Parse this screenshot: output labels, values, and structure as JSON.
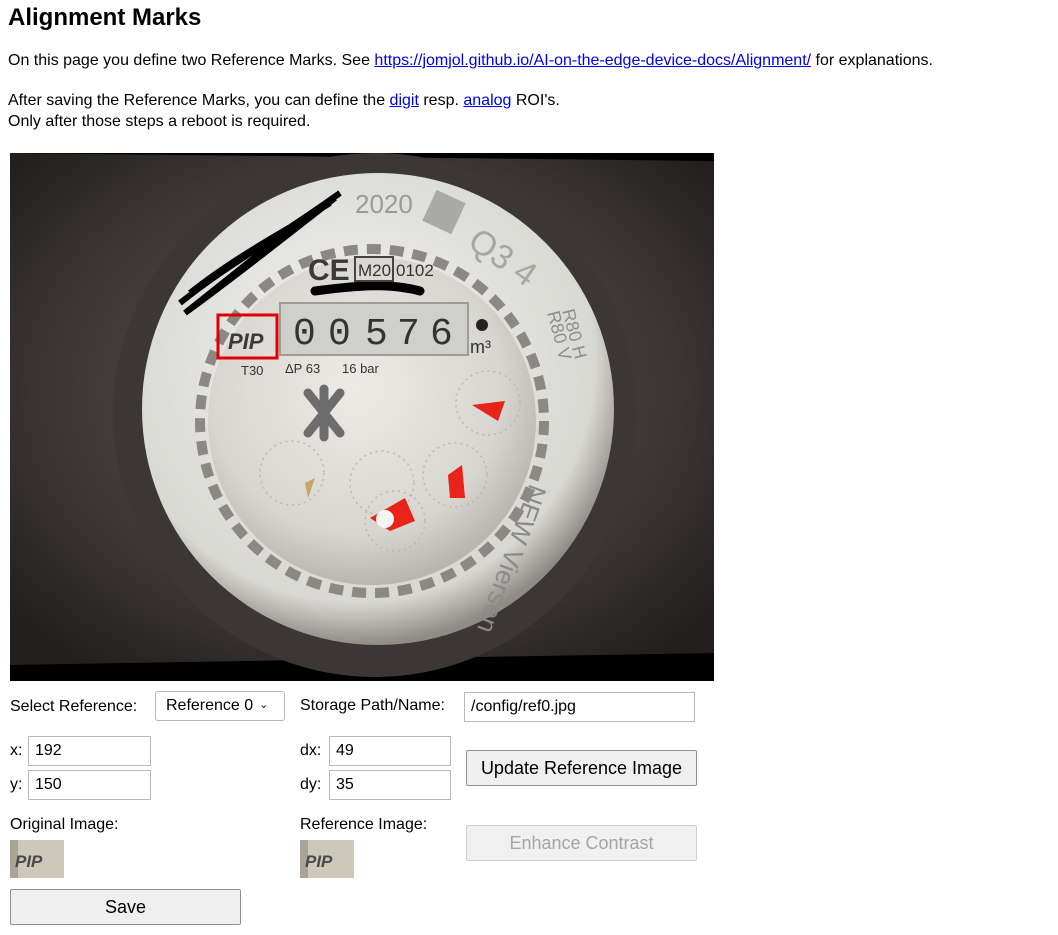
{
  "page": {
    "title": "Alignment Marks",
    "intro_prefix": "On this page you define two Reference Marks. See ",
    "intro_link": "https://jomjol.github.io/AI-on-the-edge-device-docs/Alignment/",
    "intro_suffix": " for explanations.",
    "after_prefix": "After saving the Reference Marks, you can define the ",
    "digit_link": "digit",
    "after_mid": " resp. ",
    "analog_link": "analog",
    "after_suffix": " ROI's.",
    "reboot_note": "Only after those steps a reboot is required."
  },
  "image": {
    "meter_year": "2020",
    "meter_reading": [
      "0",
      "0",
      "5",
      "7",
      "6"
    ],
    "meter_unit": "m³",
    "marking_ce": "CE",
    "marking_m": "M20",
    "marking_code": "0102",
    "marking_t": "T30",
    "marking_dp": "ΔP 63",
    "marking_bar": "16 bar",
    "marking_q": "Q3 4",
    "marking_r": "R80 H",
    "marking_r2": "R80 V",
    "marking_brand": "NEW Viersen",
    "marking_pip": "PIP",
    "highlight_color": "#e00000"
  },
  "controls": {
    "select_reference_label": "Select Reference:",
    "select_reference_value": "Reference 0",
    "storage_label": "Storage Path/Name:",
    "storage_value": "/config/ref0.jpg",
    "x_label": "x:",
    "x_value": "192",
    "y_label": "y:",
    "y_value": "150",
    "dx_label": "dx:",
    "dx_value": "49",
    "dy_label": "dy:",
    "dy_value": "35",
    "update_button": "Update Reference Image",
    "original_label": "Original Image:",
    "reference_label": "Reference Image:",
    "enhance_button": "Enhance Contrast",
    "save_button": "Save"
  }
}
